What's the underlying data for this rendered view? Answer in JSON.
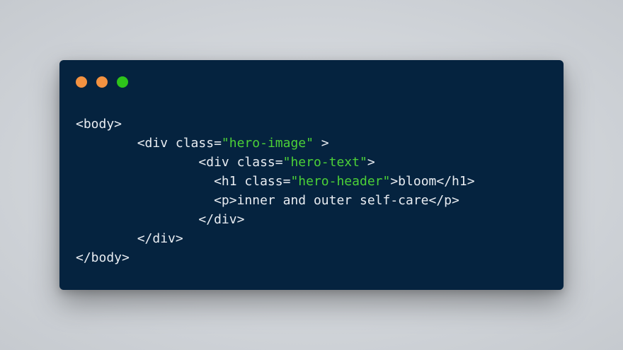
{
  "window": {
    "controls": [
      {
        "name": "close-button",
        "color": "#f39241"
      },
      {
        "name": "minimize-button",
        "color": "#f39241"
      },
      {
        "name": "zoom-button",
        "color": "#2ec41a"
      }
    ],
    "colors": {
      "background": "#05233f",
      "text": "#e9edf2",
      "string": "#4cd137"
    }
  },
  "code": {
    "lines": [
      {
        "indent": "",
        "tokens": [
          {
            "t": "<body>",
            "k": "tag"
          }
        ]
      },
      {
        "indent": "        ",
        "tokens": [
          {
            "t": "<div class=",
            "k": "tag"
          },
          {
            "t": "\"hero-image\"",
            "k": "str"
          },
          {
            "t": " >",
            "k": "tag"
          }
        ]
      },
      {
        "indent": "                ",
        "tokens": [
          {
            "t": "<div class=",
            "k": "tag"
          },
          {
            "t": "\"hero-text\"",
            "k": "str"
          },
          {
            "t": ">",
            "k": "tag"
          }
        ]
      },
      {
        "indent": "                  ",
        "tokens": [
          {
            "t": "<h1 class=",
            "k": "tag"
          },
          {
            "t": "\"hero-header\"",
            "k": "str"
          },
          {
            "t": ">bloom</h1>",
            "k": "tag"
          }
        ]
      },
      {
        "indent": "                  ",
        "tokens": [
          {
            "t": "<p>inner and outer self-care</p>",
            "k": "tag"
          }
        ]
      },
      {
        "indent": "                ",
        "tokens": [
          {
            "t": "</div>",
            "k": "tag"
          }
        ]
      },
      {
        "indent": "        ",
        "tokens": [
          {
            "t": "</div>",
            "k": "tag"
          }
        ]
      },
      {
        "indent": "",
        "tokens": [
          {
            "t": "</body>",
            "k": "tag"
          }
        ]
      }
    ]
  }
}
